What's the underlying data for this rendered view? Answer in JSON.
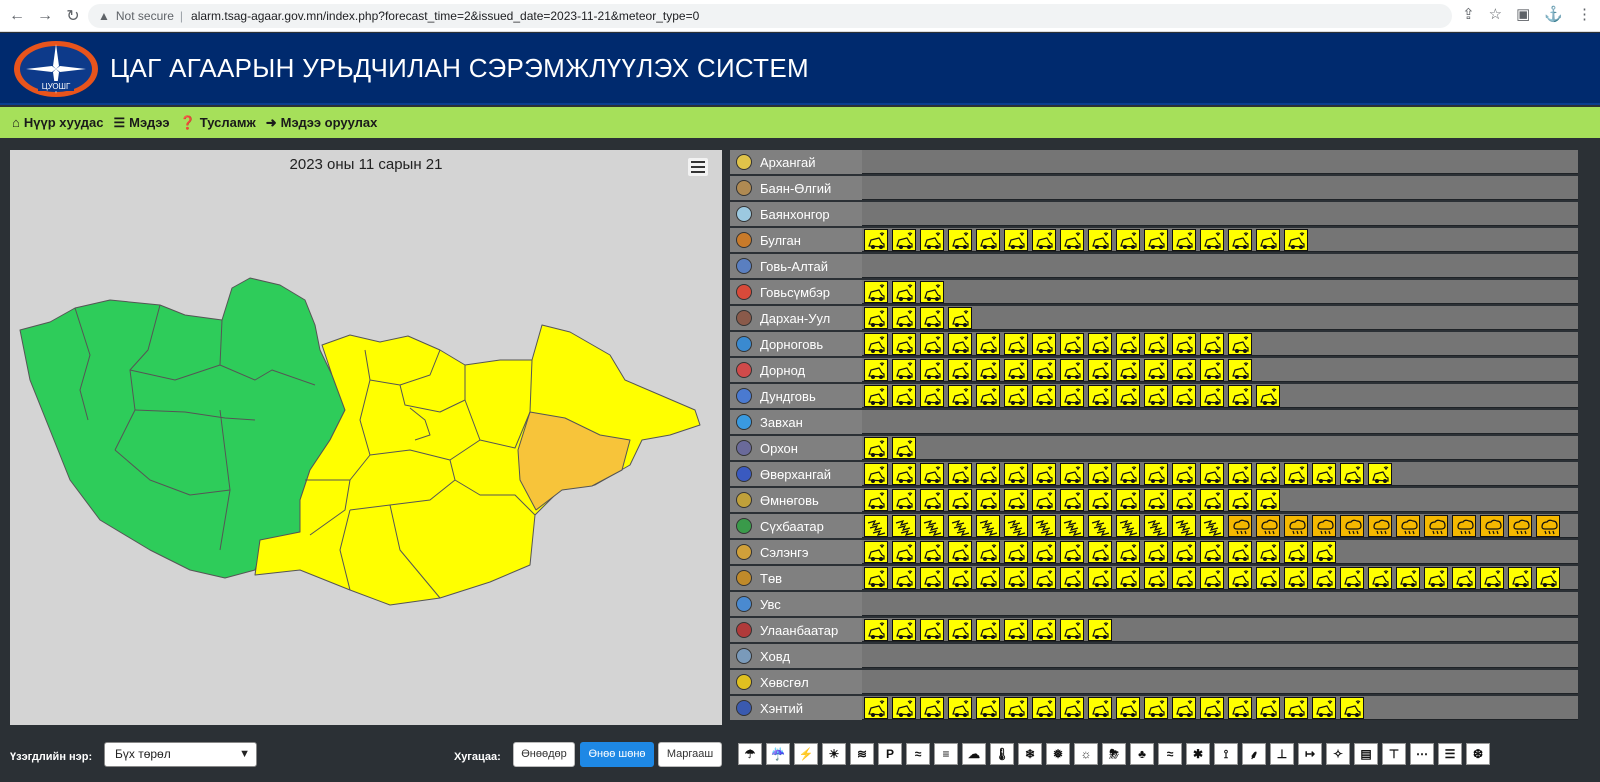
{
  "browser": {
    "security_label": "Not secure",
    "url": "alarm.tsag-agaar.gov.mn/index.php?forecast_time=2&issued_date=2023-11-21&meteor_type=0"
  },
  "header": {
    "title": "ЦАГ АГААРЫН УРЬДЧИЛАН СЭРЭМЖЛҮҮЛЭХ СИСТЕМ",
    "logo_text": "ЦУОШГ"
  },
  "menu": [
    {
      "label": "Нүүр хуудас",
      "icon": "home-icon"
    },
    {
      "label": "Мэдээ",
      "icon": "list-icon"
    },
    {
      "label": "Тусламж",
      "icon": "help-icon"
    },
    {
      "label": "Мэдээ оруулах",
      "icon": "sign-in-icon"
    }
  ],
  "map": {
    "date_title": "2023 оны 11 сарын 21",
    "colors": {
      "green": "#2ecc5a",
      "yellow": "#ffff00",
      "orange": "#f7c43a"
    }
  },
  "provinces": [
    {
      "name": "Архангай",
      "alerts": 0,
      "emblem_color": "#e0c34a"
    },
    {
      "name": "Баян-Өлгий",
      "alerts": 0,
      "emblem_color": "#b08a52"
    },
    {
      "name": "Баянхонгор",
      "alerts": 0,
      "emblem_color": "#9cc9e0"
    },
    {
      "name": "Булган",
      "alerts": 16,
      "emblem_color": "#c87a2a"
    },
    {
      "name": "Говь-Алтай",
      "alerts": 0,
      "emblem_color": "#5a7fc0"
    },
    {
      "name": "Говьсүмбэр",
      "alerts": 3,
      "emblem_color": "#d84a3a"
    },
    {
      "name": "Дархан-Уул",
      "alerts": 4,
      "emblem_color": "#8a5a4a"
    },
    {
      "name": "Дорноговь",
      "alerts": 14,
      "emblem_color": "#3a8ad0"
    },
    {
      "name": "Дорнод",
      "alerts": 14,
      "emblem_color": "#d04a4a"
    },
    {
      "name": "Дундговь",
      "alerts": 15,
      "emblem_color": "#4a7ad0"
    },
    {
      "name": "Завхан",
      "alerts": 0,
      "emblem_color": "#3a9ae0"
    },
    {
      "name": "Орхон",
      "alerts": 2,
      "emblem_color": "#6a6a9a"
    },
    {
      "name": "Өвөрхангай",
      "alerts": 19,
      "emblem_color": "#3a5ac0"
    },
    {
      "name": "Өмнөговь",
      "alerts": 15,
      "emblem_color": "#c0a03a"
    },
    {
      "name": "Сүхбаатар",
      "alerts": 26,
      "orange_from": 13,
      "emblem_color": "#3a9a4a"
    },
    {
      "name": "Сэлэнгэ",
      "alerts": 17,
      "emblem_color": "#d0a03a"
    },
    {
      "name": "Төв",
      "alerts": 26,
      "emblem_color": "#c08a2a"
    },
    {
      "name": "Увс",
      "alerts": 0,
      "emblem_color": "#4a8ad0"
    },
    {
      "name": "Улаанбаатар",
      "alerts": 9,
      "emblem_color": "#b03a3a"
    },
    {
      "name": "Ховд",
      "alerts": 0,
      "emblem_color": "#7a9aba"
    },
    {
      "name": "Хөвсгөл",
      "alerts": 0,
      "emblem_color": "#e0c020"
    },
    {
      "name": "Хэнтий",
      "alerts": 18,
      "emblem_color": "#3a5ab0"
    }
  ],
  "controls": {
    "phenomenon_label": "Үзэгдлийн нэр:",
    "phenomenon_value": "Бүх төрөл",
    "period_label": "Хугацаа:",
    "period_buttons": [
      "Өнөөдөр",
      "Өнөө шөнө",
      "Маргааш"
    ],
    "period_active": 1
  },
  "legend_icons": [
    "rain-icon",
    "heavy-rain-icon",
    "lightning-icon",
    "sun-icon",
    "heat-icon",
    "parking-icon",
    "snowstorm-icon",
    "fog-icon",
    "shower-icon",
    "temperature-icon",
    "snow-icon",
    "cloud-snow-icon",
    "sun-haze-icon",
    "storm-icon",
    "tree-icon",
    "flood-icon",
    "cold-icon",
    "tornado-icon",
    "drizzle-icon",
    "thermo-low-icon",
    "wind-icon",
    "freeze-icon",
    "car-snow-icon",
    "thermo-high-icon",
    "dust-icon",
    "mist-icon",
    "ice-icon"
  ]
}
